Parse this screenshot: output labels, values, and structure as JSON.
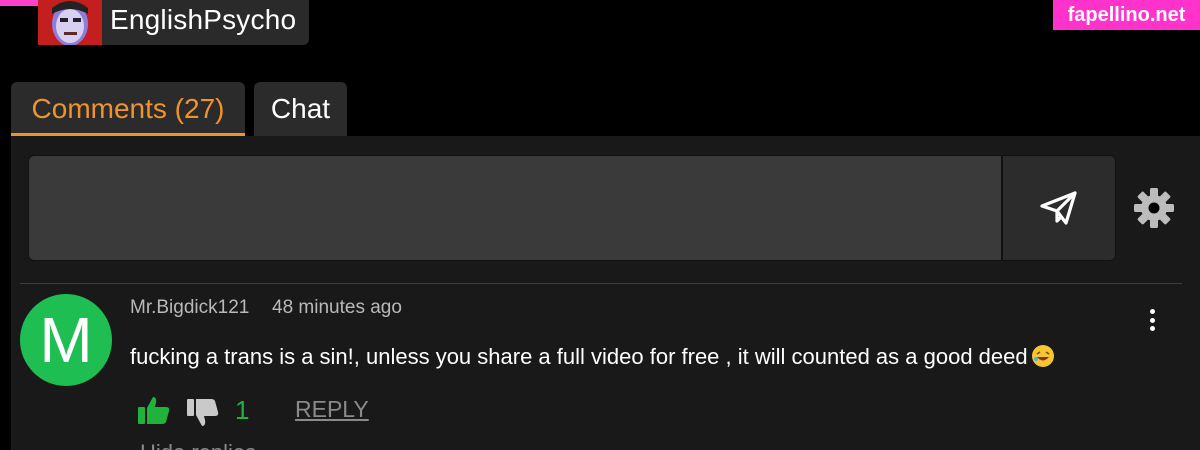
{
  "user": {
    "name": "EnglishPsycho",
    "avatar_icon": "user-avatar-icon"
  },
  "watermark": {
    "text": "fapellino.net",
    "color": "#ff33cc"
  },
  "tabs": [
    {
      "label": "Comments (27)",
      "active": true
    },
    {
      "label": "Chat",
      "active": false
    }
  ],
  "composer": {
    "placeholder": "",
    "send_icon": "send-icon",
    "settings_icon": "gear-icon"
  },
  "comments": [
    {
      "avatar_letter": "M",
      "avatar_color": "#1fbe52",
      "author": "Mr.Bigdick121",
      "time": "48 minutes ago",
      "text": "fucking a trans is a sin!, unless you share a full video for free , it will counted as a good deed",
      "emoji": "rolling-on-floor-laughing",
      "votes": "1",
      "reply_label": "REPLY",
      "hide_replies_label": "Hide replies"
    }
  ],
  "colors": {
    "accent": "#f0932b",
    "like": "#20b23a",
    "background": "#000000",
    "panel": "#191919"
  }
}
